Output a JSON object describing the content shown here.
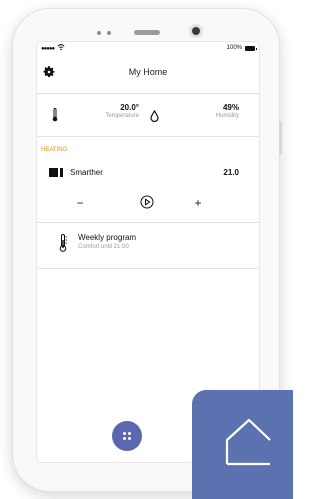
{
  "status_bar": {
    "signal": "●●●●●",
    "wifi": "wifi-icon",
    "battery_pct": "100%"
  },
  "header": {
    "title": "My Home",
    "settings_icon": "gear-icon"
  },
  "sensors": {
    "temperature": {
      "value": "20.0°",
      "label": "Temperature",
      "icon": "thermometer-icon"
    },
    "humidity": {
      "value": "49%",
      "label": "Humidity",
      "icon": "water-drop-icon"
    }
  },
  "heating": {
    "section_label": "HEATING",
    "device": {
      "name": "Smarther",
      "value": "21.0",
      "icon": "thermostat-device-icon"
    },
    "controls": {
      "decrease": "−",
      "increase": "+",
      "play_icon": "play-circle-icon"
    },
    "program": {
      "title": "Weekly program",
      "subtitle": "Comfort until 21:00",
      "icon": "thermometer-icon"
    }
  },
  "fab": {
    "icon": "grid-dots-icon"
  },
  "home_tile": {
    "icon": "home-icon"
  },
  "colors": {
    "accent_orange": "#e58e1f",
    "brand_blue": "#5b68b0",
    "tile_blue": "#5b71b0"
  }
}
